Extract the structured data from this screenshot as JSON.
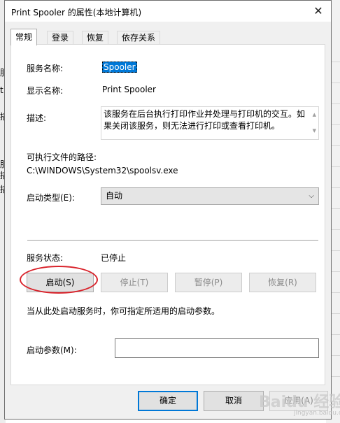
{
  "window": {
    "title": "Print Spooler 的属性(本地计算机)",
    "close_glyph": "✕"
  },
  "background": {
    "fragments": [
      "服",
      "t",
      "描",
      "服",
      "描",
      "描"
    ]
  },
  "tabs": [
    {
      "label": "常规",
      "active": true
    },
    {
      "label": "登录"
    },
    {
      "label": "恢复"
    },
    {
      "label": "依存关系"
    }
  ],
  "general": {
    "service_name_label": "服务名称:",
    "service_name_value": "Spooler",
    "display_name_label": "显示名称:",
    "display_name_value": "Print Spooler",
    "description_label": "描述:",
    "description_value": "该服务在后台执行打印作业并处理与打印机的交互。如果关闭该服务，则无法进行打印或查看打印机。",
    "path_label": "可执行文件的路径:",
    "path_value": "C:\\WINDOWS\\System32\\spoolsv.exe",
    "startup_type_label": "启动类型(E):",
    "startup_type_value": "自动",
    "status_label": "服务状态:",
    "status_value": "已停止",
    "buttons": {
      "start": "启动(S)",
      "stop": "停止(T)",
      "pause": "暂停(P)",
      "resume": "恢复(R)"
    },
    "hint": "当从此处启动服务时，你可指定所适用的启动参数。",
    "params_label": "启动参数(M):"
  },
  "footer": {
    "ok": "确定",
    "cancel": "取消",
    "apply": "应用(A)"
  },
  "watermark": {
    "text": "Baidu 经验",
    "sub": "jingyan.baidu.com"
  },
  "colors": {
    "accent": "#0078d7",
    "annotation_red": "#d9232b"
  }
}
